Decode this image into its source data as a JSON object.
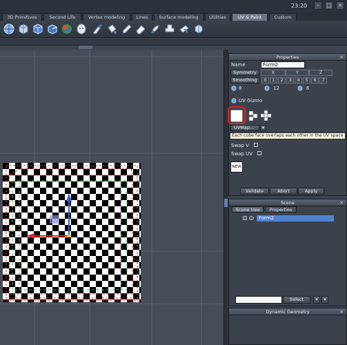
{
  "clock": "23:20",
  "tabs": [
    {
      "label": "3D Primitives",
      "active": false
    },
    {
      "label": "Second Life",
      "active": false
    },
    {
      "label": "Vertex modeling",
      "active": false
    },
    {
      "label": "Lines",
      "active": false
    },
    {
      "label": "Surface modeling",
      "active": false
    },
    {
      "label": "Utilities",
      "active": false
    },
    {
      "label": "UV & Paint",
      "active": true
    },
    {
      "label": "Custom",
      "active": false
    }
  ],
  "toolbar_icons": [
    "sphere-uv-icon",
    "cube-checker-icon",
    "cube-blue-icon",
    "cube-open-icon",
    "palette-sphere-icon",
    "head-icon",
    "paint-brush-icon",
    "paint-bucket-icon",
    "pencil-icon",
    "eraser-icon",
    "smudge-icon",
    "stamp-icon",
    "spray-icon",
    "uv-move-icon",
    "cube-arrows-icon"
  ],
  "properties": {
    "title": "Properties",
    "name_label": "Name",
    "name_value": "Form2",
    "symmetry_label": "Symmetry",
    "axes": [
      "X",
      "Y",
      "Z"
    ],
    "smoothing_label": "Smoothing",
    "smoothing_levels": [
      "0",
      "1",
      "2",
      "3",
      "4",
      "5",
      "6",
      "7"
    ],
    "counts": [
      "8",
      "12",
      "6"
    ],
    "uv_gizmo_label": "UV Gizmo",
    "uvmap_label": "UVMap...",
    "tooltip": "Each cube face overlaps each other in the UV space",
    "swap_v_label": "Swap V",
    "swap_uv_label": "Swap UV",
    "new_label": "NEW",
    "validate_label": "Validate",
    "abort_label": "Abort",
    "apply_label": "Apply"
  },
  "scene": {
    "title": "Scene",
    "tabs": [
      "Scene tree",
      "Properties"
    ],
    "active_tab": "Scene tree",
    "tree_item": "Form2",
    "select_label": "Select"
  },
  "dynamic_geometry": {
    "title": "Dynamic Geometry"
  },
  "colors": {
    "accent": "#4f83d1",
    "highlight_ring": "#e02424",
    "viewport_bg": "#474d57"
  }
}
